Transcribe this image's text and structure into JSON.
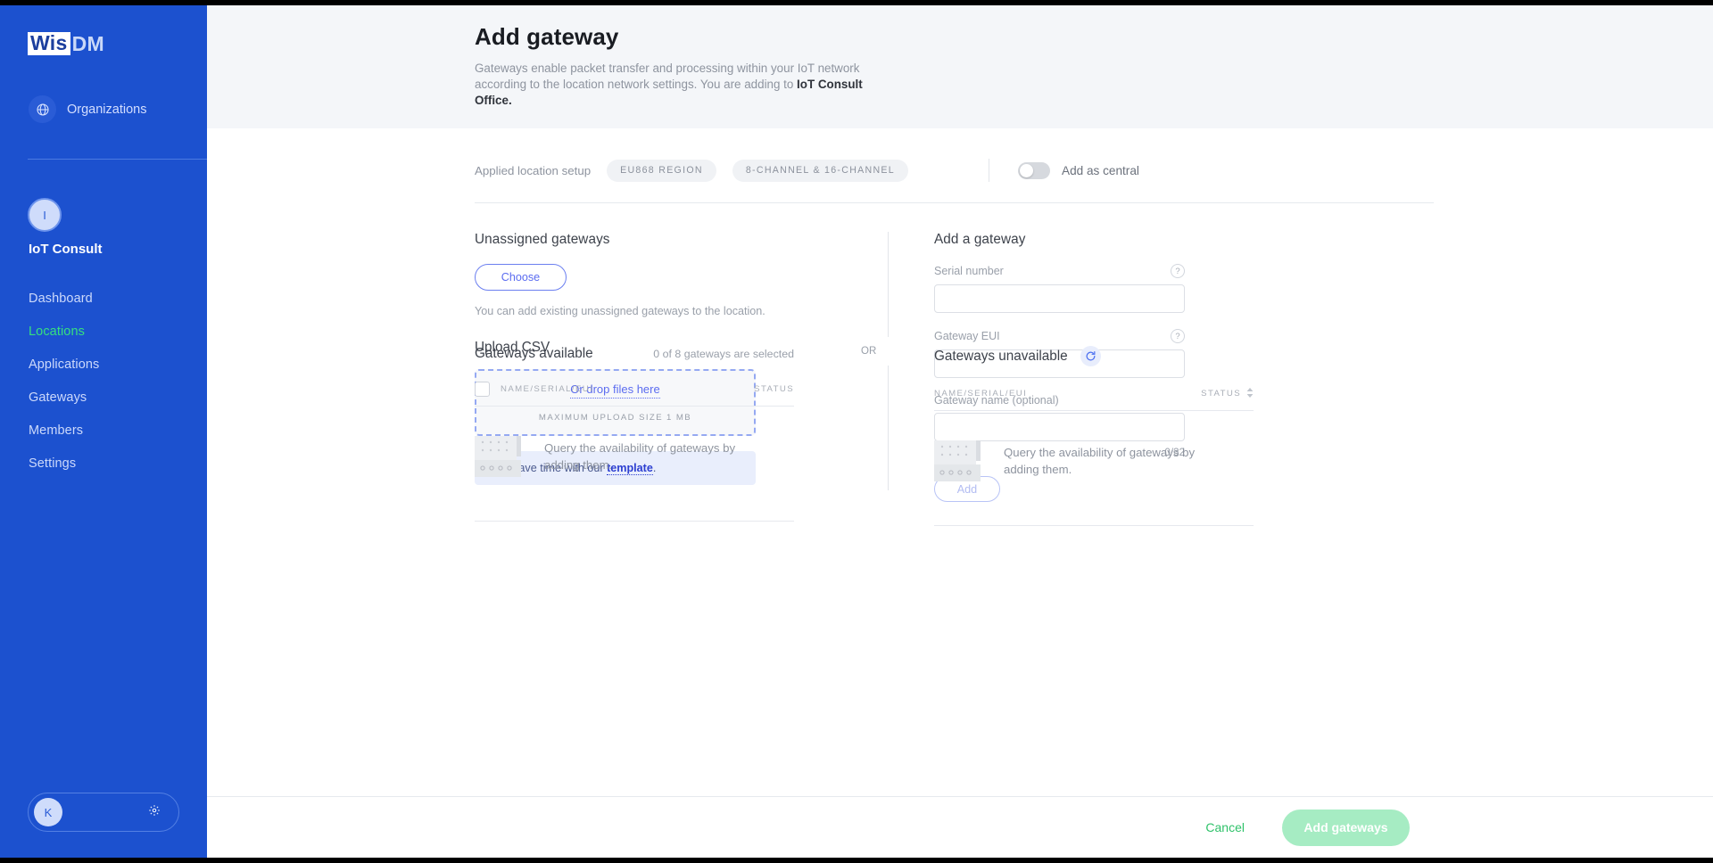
{
  "sidebar": {
    "logo_primary": "Wis",
    "logo_secondary": "DM",
    "globe_icon": "globe-icon",
    "organizations_label": "Organizations",
    "org_avatar_initial": "I",
    "org_name": "IoT Consult",
    "nav_items": [
      {
        "label": "Dashboard",
        "active": false
      },
      {
        "label": "Locations",
        "active": true
      },
      {
        "label": "Applications",
        "active": false
      },
      {
        "label": "Gateways",
        "active": false
      },
      {
        "label": "Members",
        "active": false
      },
      {
        "label": "Settings",
        "active": false
      }
    ],
    "user_initial": "K",
    "gear_icon": "gear-icon"
  },
  "header": {
    "title": "Add gateway",
    "description_part1": "Gateways enable packet transfer and processing within your IoT network according to the location network settings. You are adding to ",
    "description_bold": "IoT Consult Office.",
    "accent_color": "#1c51cf"
  },
  "setup": {
    "label": "Applied location setup",
    "chips": [
      "EU868 REGION",
      "8-CHANNEL & 16-CHANNEL"
    ],
    "toggle_label": "Add as central",
    "toggle_state": "off"
  },
  "unassigned": {
    "title": "Unassigned gateways",
    "choose_label": "Choose",
    "help_text": "You can add existing unassigned gateways to the location.",
    "upload_title": "Upload CSV",
    "drop_link": "Or drop files here",
    "max_size": "MAXIMUM UPLOAD SIZE 1 MB",
    "info_icon": "info-circle-icon",
    "info_prefix": "Save time with our ",
    "info_link": "template",
    "info_suffix": "."
  },
  "or_label": "OR",
  "add_form": {
    "title": "Add a gateway",
    "fields": [
      {
        "label": "Serial number",
        "value": "",
        "placeholder": "",
        "help_icon": "question-mark-icon"
      },
      {
        "label": "Gateway EUI",
        "value": "",
        "placeholder": "",
        "help_icon": "question-mark-icon"
      },
      {
        "label": "Gateway name (optional)",
        "value": "",
        "placeholder": "",
        "help_icon": ""
      }
    ],
    "counter": "0/32",
    "add_label": "Add"
  },
  "tables": {
    "available": {
      "title": "Gateways available",
      "count_text": "0 of 8 gateways are selected",
      "col_name": "NAME/SERIAL/EUI",
      "col_status": "STATUS",
      "empty_icon": "gateway-device-icon",
      "empty_text": "Query the availability of gateways by adding them."
    },
    "unavailable": {
      "title": "Gateways unavailable",
      "refresh_icon": "refresh-icon",
      "col_name": "NAME/SERIAL/EUI",
      "col_status": "STATUS",
      "sort_icon": "sort-updown-icon",
      "empty_icon": "gateway-device-icon",
      "empty_text": "Query the availability of gateways by adding them."
    }
  },
  "footer": {
    "cancel_label": "Cancel",
    "submit_label": "Add gateways",
    "submit_color": "#a6ecc3",
    "cancel_color": "#2fc26a"
  }
}
